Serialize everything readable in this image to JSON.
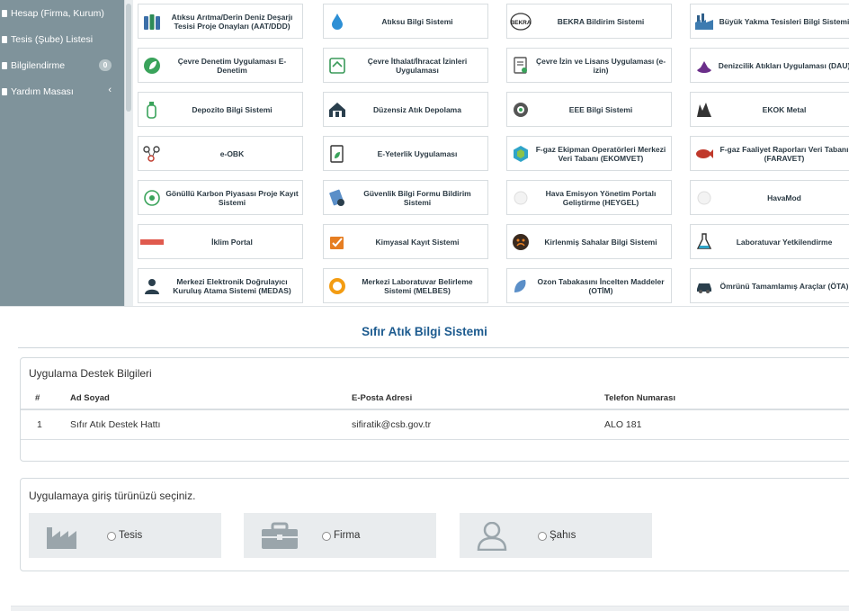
{
  "sidebar": {
    "items": [
      {
        "label": "Hesap (Firma, Kurum)"
      },
      {
        "label": "Tesis (Şube) Listesi"
      },
      {
        "label": "Bilgilendirme",
        "badge": "0"
      },
      {
        "label": "Yardım Masası",
        "chevron": "‹"
      }
    ]
  },
  "apps": [
    {
      "label": "Atıksu Arıtma/Derin Deniz Deşarjı Tesisi Proje Onayları (AAT/DDD)",
      "icon": "bottles-icon"
    },
    {
      "label": "Atıksu Bilgi Sistemi",
      "icon": "water-drop-icon"
    },
    {
      "label": "BEKRA Bildirim Sistemi",
      "icon": "bekra-logo-icon"
    },
    {
      "label": "Büyük Yakma Tesisleri Bilgi Sistemi",
      "icon": "factory-icon"
    },
    {
      "label": "Çevre Denetim Uygulaması E-Denetim",
      "icon": "leaf-circle-icon"
    },
    {
      "label": "Çevre İthalat/İhracat İzinleri Uygulaması",
      "icon": "import-export-icon"
    },
    {
      "label": "Çevre İzin ve Lisans Uygulaması (e-izin)",
      "icon": "license-document-icon"
    },
    {
      "label": "Denizcilik Atıkları Uygulaması (DAU)",
      "icon": "ship-anchor-icon"
    },
    {
      "label": "Depozito Bilgi Sistemi",
      "icon": "bottle-recycle-icon"
    },
    {
      "label": "Düzensiz Atık Depolama",
      "icon": "house-icon"
    },
    {
      "label": "EEE Bilgi Sistemi",
      "icon": "electronics-icon"
    },
    {
      "label": "EKOK Metal",
      "icon": "metal-icon"
    },
    {
      "label": "e-OBK",
      "icon": "molecule-icon"
    },
    {
      "label": "E-Yeterlik Uygulaması",
      "icon": "document-leaf-icon"
    },
    {
      "label": "F-gaz Ekipman Operatörleri Merkezi Veri Tabanı (EKOMVET)",
      "icon": "hexagon-icon"
    },
    {
      "label": "F-gaz Faaliyet Raporları Veri Tabanı (FARAVET)",
      "icon": "fish-icon"
    },
    {
      "label": "Gönüllü Karbon Piyasası Proje Kayıt Sistemi",
      "icon": "carbon-cycle-icon"
    },
    {
      "label": "Güvenlik Bilgi Formu Bildirim Sistemi",
      "icon": "safety-form-icon"
    },
    {
      "label": "Hava Emisyon Yönetim Portalı Geliştirme (HEYGEL)",
      "icon": "air-emission-icon"
    },
    {
      "label": "HavaMod",
      "icon": "havamod-icon"
    },
    {
      "label": "İklim Portal",
      "icon": "climate-portal-icon"
    },
    {
      "label": "Kimyasal Kayıt Sistemi",
      "icon": "chemical-registry-icon"
    },
    {
      "label": "Kirlenmiş Sahalar Bilgi Sistemi",
      "icon": "polluted-site-icon"
    },
    {
      "label": "Laboratuvar Yetkilendirme",
      "icon": "flask-icon"
    },
    {
      "label": "Merkezi Elektronik Doğrulayıcı Kuruluş Atama Sistemi (MEDAS)",
      "icon": "person-screen-icon"
    },
    {
      "label": "Merkezi Laboratuvar Belirleme Sistemi (MELBES)",
      "icon": "lab-sun-icon"
    },
    {
      "label": "Ozon Tabakasını İncelten Maddeler (OTİM)",
      "icon": "ozone-icon"
    },
    {
      "label": "Ömrünü Tamamlamış Araçlar (ÖTA)",
      "icon": "car-icon"
    }
  ],
  "main": {
    "title": "Sıfır Atık Bilgi Sistemi",
    "support": {
      "title": "Uygulama Destek Bilgileri",
      "columns": [
        "#",
        "Ad Soyad",
        "E-Posta Adresi",
        "Telefon Numarası"
      ],
      "rows": [
        {
          "no": "1",
          "name": "Sıfır Atık Destek Hattı",
          "email": "sifiratik@csb.gov.tr",
          "phone": "ALO 181"
        }
      ]
    },
    "entry": {
      "title": "Uygulamaya giriş türünüzü seçiniz.",
      "options": [
        {
          "label": "Tesis",
          "icon": "factory-silhouette-icon"
        },
        {
          "label": "Firma",
          "icon": "briefcase-icon"
        },
        {
          "label": "Şahıs",
          "icon": "user-icon"
        }
      ]
    }
  },
  "colors": {
    "sidebar": "#7f939b",
    "title": "#1d5b8f",
    "entry_bg": "#e9ecee"
  }
}
